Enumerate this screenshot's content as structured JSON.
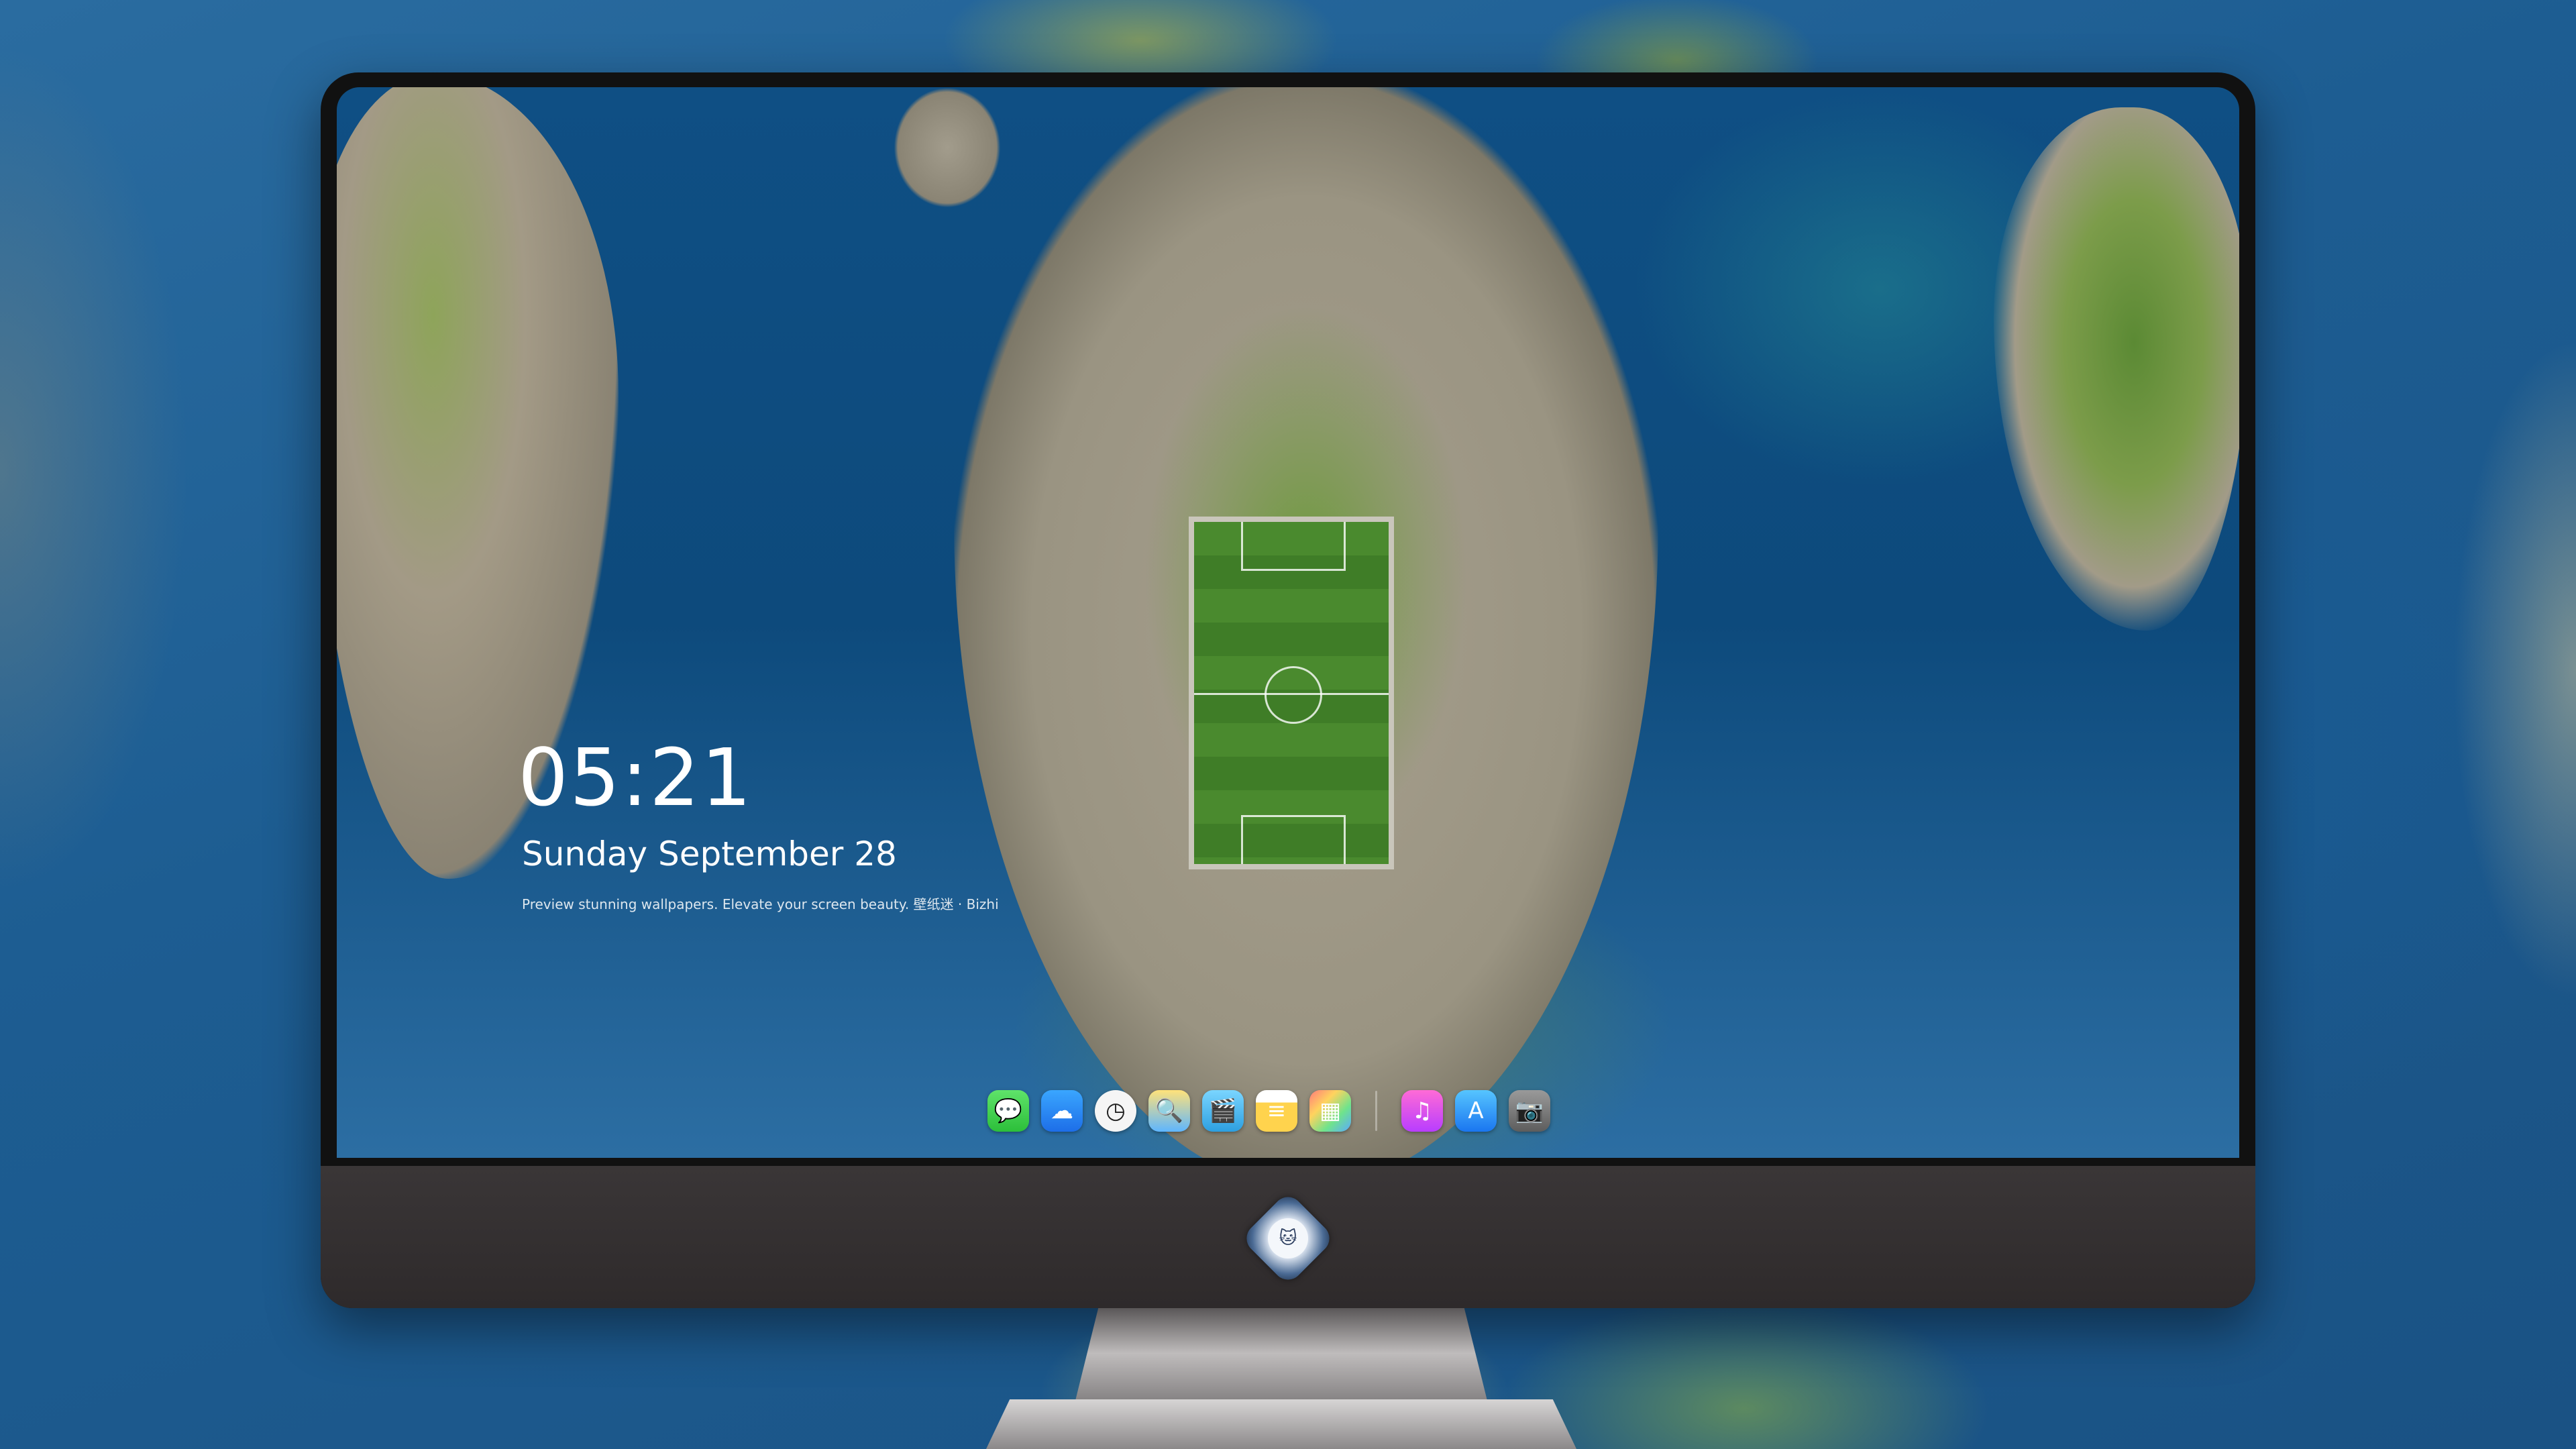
{
  "lock_screen": {
    "time": "05:21",
    "date": "Sunday September  28",
    "caption": "Preview stunning wallpapers. Elevate your screen beauty. 壁纸迷 · Bizhi"
  },
  "dock": {
    "apps": [
      {
        "name": "messages-icon",
        "glyph": "💬"
      },
      {
        "name": "weather-icon",
        "glyph": "☁"
      },
      {
        "name": "clock-icon",
        "glyph": "◷"
      },
      {
        "name": "preview-icon",
        "glyph": "🔍"
      },
      {
        "name": "clips-icon",
        "glyph": "🎬"
      },
      {
        "name": "notes-icon",
        "glyph": "≡"
      },
      {
        "name": "photos-icon",
        "glyph": "▦"
      },
      {
        "name": "music-icon",
        "glyph": "♫"
      },
      {
        "name": "app-store-icon",
        "glyph": "A"
      },
      {
        "name": "camera-icon",
        "glyph": "📷"
      }
    ]
  },
  "monitor": {
    "logo_icon": "cat-mascot-logo-icon",
    "logo_glyph": "🐱"
  }
}
